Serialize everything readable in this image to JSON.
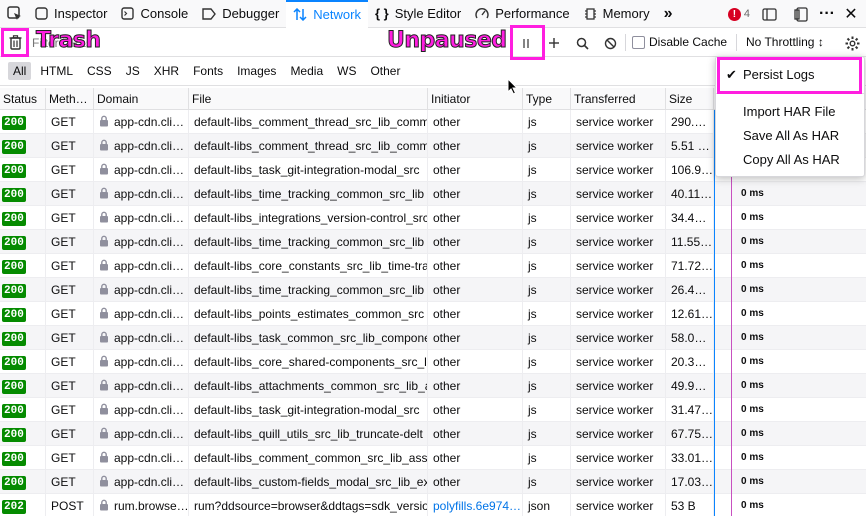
{
  "devtools_tabs": [
    {
      "label": "Inspector",
      "icon": "inspector-icon"
    },
    {
      "label": "Console",
      "icon": "console-icon"
    },
    {
      "label": "Debugger",
      "icon": "debugger-icon"
    },
    {
      "label": "Network",
      "icon": "network-icon",
      "active": true
    },
    {
      "label": "Style Editor",
      "icon": "style-editor-icon"
    },
    {
      "label": "Performance",
      "icon": "performance-icon"
    },
    {
      "label": "Memory",
      "icon": "memory-icon"
    }
  ],
  "error_count": "4",
  "toolbar": {
    "filter_placeholder": "Filter URLs",
    "disable_cache_label": "Disable Cache",
    "throttling_label": "No Throttling ↕"
  },
  "type_filters": [
    "All",
    "HTML",
    "CSS",
    "JS",
    "XHR",
    "Fonts",
    "Images",
    "Media",
    "WS",
    "Other"
  ],
  "columns": [
    "Status",
    "Meth…",
    "Domain",
    "File",
    "Initiator",
    "Type",
    "Transferred",
    "Size"
  ],
  "rows": [
    {
      "status": "200",
      "method": "GET",
      "domain": "app-cdn.cli…",
      "file": "default-libs_comment_thread_src_lib_comm",
      "initiator": "other",
      "type": "js",
      "transferred": "service worker",
      "size": "290.…"
    },
    {
      "status": "200",
      "method": "GET",
      "domain": "app-cdn.cli…",
      "file": "default-libs_comment_thread_src_lib_comm",
      "initiator": "other",
      "type": "js",
      "transferred": "service worker",
      "size": "5.51 …"
    },
    {
      "status": "200",
      "method": "GET",
      "domain": "app-cdn.cli…",
      "file": "default-libs_task_git-integration-modal_src",
      "initiator": "other",
      "type": "js",
      "transferred": "service worker",
      "size": "106.9…"
    },
    {
      "status": "200",
      "method": "GET",
      "domain": "app-cdn.cli…",
      "file": "default-libs_time_tracking_common_src_lib",
      "initiator": "other",
      "type": "js",
      "transferred": "service worker",
      "size": "40.11…",
      "timing": "0 ms"
    },
    {
      "status": "200",
      "method": "GET",
      "domain": "app-cdn.cli…",
      "file": "default-libs_integrations_version-control_src",
      "initiator": "other",
      "type": "js",
      "transferred": "service worker",
      "size": "34.4…",
      "timing": "0 ms"
    },
    {
      "status": "200",
      "method": "GET",
      "domain": "app-cdn.cli…",
      "file": "default-libs_time_tracking_common_src_lib",
      "initiator": "other",
      "type": "js",
      "transferred": "service worker",
      "size": "11.55…",
      "timing": "0 ms"
    },
    {
      "status": "200",
      "method": "GET",
      "domain": "app-cdn.cli…",
      "file": "default-libs_core_constants_src_lib_time-tra",
      "initiator": "other",
      "type": "js",
      "transferred": "service worker",
      "size": "71.72…",
      "timing": "0 ms"
    },
    {
      "status": "200",
      "method": "GET",
      "domain": "app-cdn.cli…",
      "file": "default-libs_time_tracking_common_src_lib",
      "initiator": "other",
      "type": "js",
      "transferred": "service worker",
      "size": "26.4…",
      "timing": "0 ms"
    },
    {
      "status": "200",
      "method": "GET",
      "domain": "app-cdn.cli…",
      "file": "default-libs_points_estimates_common_src",
      "initiator": "other",
      "type": "js",
      "transferred": "service worker",
      "size": "12.61…",
      "timing": "0 ms"
    },
    {
      "status": "200",
      "method": "GET",
      "domain": "app-cdn.cli…",
      "file": "default-libs_task_common_src_lib_compone",
      "initiator": "other",
      "type": "js",
      "transferred": "service worker",
      "size": "58.0…",
      "timing": "0 ms"
    },
    {
      "status": "200",
      "method": "GET",
      "domain": "app-cdn.cli…",
      "file": "default-libs_core_shared-components_src_l",
      "initiator": "other",
      "type": "js",
      "transferred": "service worker",
      "size": "20.3…",
      "timing": "0 ms"
    },
    {
      "status": "200",
      "method": "GET",
      "domain": "app-cdn.cli…",
      "file": "default-libs_attachments_common_src_lib_a",
      "initiator": "other",
      "type": "js",
      "transferred": "service worker",
      "size": "49.9…",
      "timing": "0 ms"
    },
    {
      "status": "200",
      "method": "GET",
      "domain": "app-cdn.cli…",
      "file": "default-libs_task_git-integration-modal_src",
      "initiator": "other",
      "type": "js",
      "transferred": "service worker",
      "size": "31.47…",
      "timing": "0 ms"
    },
    {
      "status": "200",
      "method": "GET",
      "domain": "app-cdn.cli…",
      "file": "default-libs_quill_utils_src_lib_truncate-delt",
      "initiator": "other",
      "type": "js",
      "transferred": "service worker",
      "size": "67.75…",
      "timing": "0 ms"
    },
    {
      "status": "200",
      "method": "GET",
      "domain": "app-cdn.cli…",
      "file": "default-libs_comment_common_src_lib_assi",
      "initiator": "other",
      "type": "js",
      "transferred": "service worker",
      "size": "33.01…",
      "timing": "0 ms"
    },
    {
      "status": "200",
      "method": "GET",
      "domain": "app-cdn.cli…",
      "file": "default-libs_custom-fields_modal_src_lib_ex",
      "initiator": "other",
      "type": "js",
      "transferred": "service worker",
      "size": "17.03…",
      "timing": "0 ms"
    },
    {
      "status": "202",
      "method": "POST",
      "domain": "rum.browse…",
      "file": "rum?ddsource=browser&ddtags=sdk_versio",
      "initiator": "polyfills.6e974…",
      "type": "json",
      "transferred": "service worker",
      "size": "53 B",
      "timing": "0 ms"
    }
  ],
  "settings_menu": {
    "persist_logs": "Persist Logs",
    "import_har": "Import HAR File",
    "save_har": "Save All As HAR",
    "copy_har": "Copy All As HAR"
  },
  "annotations": {
    "trash": "Trash",
    "unpaused": "Unpaused"
  },
  "colors": {
    "accent": "#0a84ff",
    "status_ok": "#058b00",
    "annotation": "#ff1ee0",
    "error": "#d70022"
  }
}
